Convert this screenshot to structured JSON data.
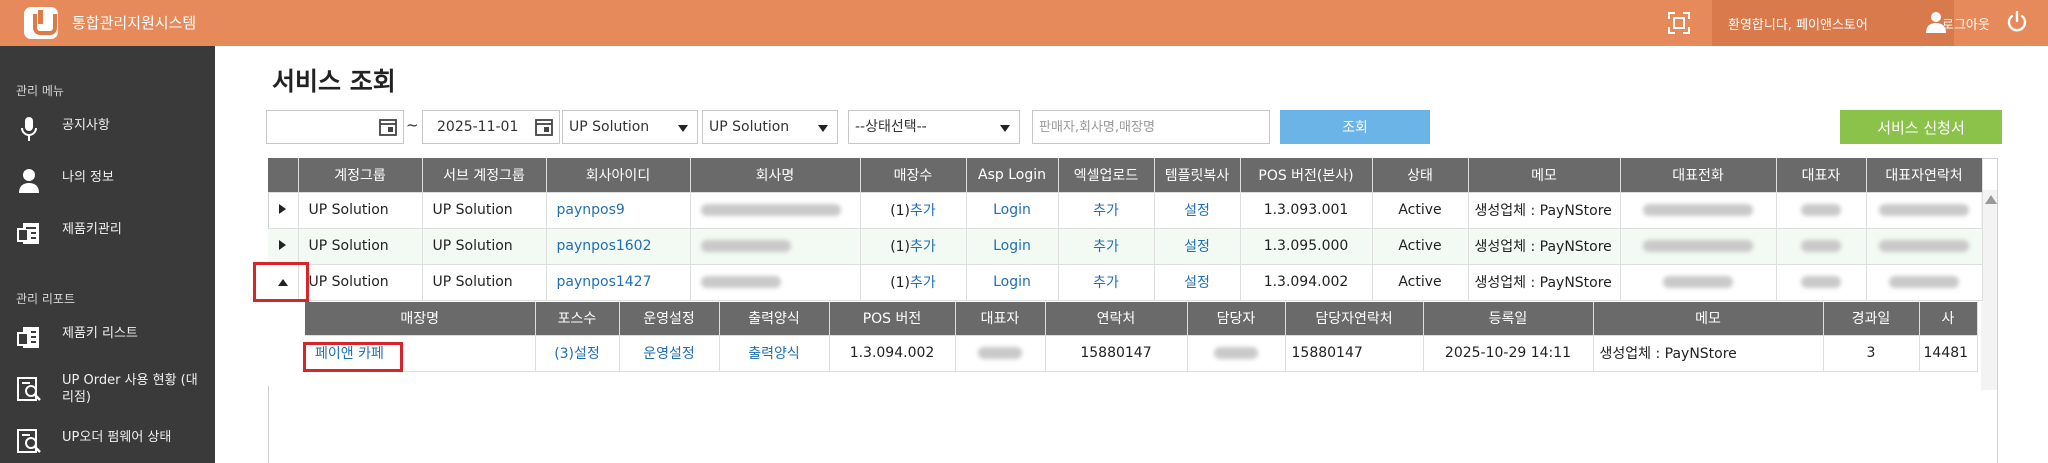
{
  "header": {
    "app_title": "통합관리지원시스템",
    "welcome": "환영합니다, 페이앤스토어",
    "logout": "로그아웃",
    "accent": "#e68a5c"
  },
  "sidebar": {
    "section1": "관리 메뉴",
    "items1": [
      {
        "label": "공지사항",
        "icon": "microphone-icon"
      },
      {
        "label": "나의 정보",
        "icon": "user-icon"
      },
      {
        "label": "제품키관리",
        "icon": "document-icon"
      }
    ],
    "section2": "관리 리포트",
    "items2": [
      {
        "label": "제품키 리스트",
        "icon": "document-icon"
      },
      {
        "label": "UP Order 사용 현황 (대리점)",
        "icon": "report-search-icon"
      },
      {
        "label": "UP오더 펌웨어 상태",
        "icon": "report-search-icon"
      }
    ]
  },
  "page": {
    "title": "서비스 조회"
  },
  "filters": {
    "start_date": "",
    "end_date": "2025-11-01",
    "select1": "UP Solution",
    "select2": "UP Solution",
    "status_select": "--상태선택--",
    "search_placeholder": "판매자,회사명,매장명",
    "search_button": "조회",
    "apply_button": "서비스 신청서"
  },
  "main_table": {
    "headers": [
      "계정그룹",
      "서브 계정그룹",
      "회사아이디",
      "회사명",
      "매장수",
      "Asp Login",
      "엑셀업로드",
      "템플릿복사",
      "POS 버전(본사)",
      "상태",
      "메모",
      "대표전화",
      "대표자",
      "대표자연락처"
    ],
    "rows": [
      {
        "group": "UP Solution",
        "sub_group": "UP Solution",
        "company_id": "paynpos9",
        "store_count": "(1)",
        "add": "추가",
        "login": "Login",
        "excel": "추가",
        "template": "설정",
        "pos_version": "1.3.093.001",
        "status": "Active",
        "memo": "생성업체 : PayNStore"
      },
      {
        "group": "UP Solution",
        "sub_group": "UP Solution",
        "company_id": "paynpos1602",
        "store_count": "(1)",
        "add": "추가",
        "login": "Login",
        "excel": "추가",
        "template": "설정",
        "pos_version": "1.3.095.000",
        "status": "Active",
        "memo": "생성업체 : PayNStore"
      },
      {
        "group": "UP Solution",
        "sub_group": "UP Solution",
        "company_id": "paynpos1427",
        "store_count": "(1)",
        "add": "추가",
        "login": "Login",
        "excel": "추가",
        "template": "설정",
        "pos_version": "1.3.094.002",
        "status": "Active",
        "memo": "생성업체 : PayNStore"
      }
    ]
  },
  "sub_table": {
    "headers": [
      "매장명",
      "포스수",
      "운영설정",
      "출력양식",
      "POS 버전",
      "대표자",
      "연락처",
      "담당자",
      "담당자연락처",
      "등록일",
      "메모",
      "경과일",
      "사"
    ],
    "row": {
      "store_name": "페이앤 카페",
      "pos_count": "(3)",
      "pos_setting": "설정",
      "operation": "운영설정",
      "print_form": "출력양식",
      "pos_version": "1.3.094.002",
      "contact": "15880147",
      "manager_contact": "15880147",
      "registered": "2025-10-29 14:11",
      "memo": "생성업체 : PayNStore",
      "elapsed": "3",
      "extra": "14481"
    }
  }
}
